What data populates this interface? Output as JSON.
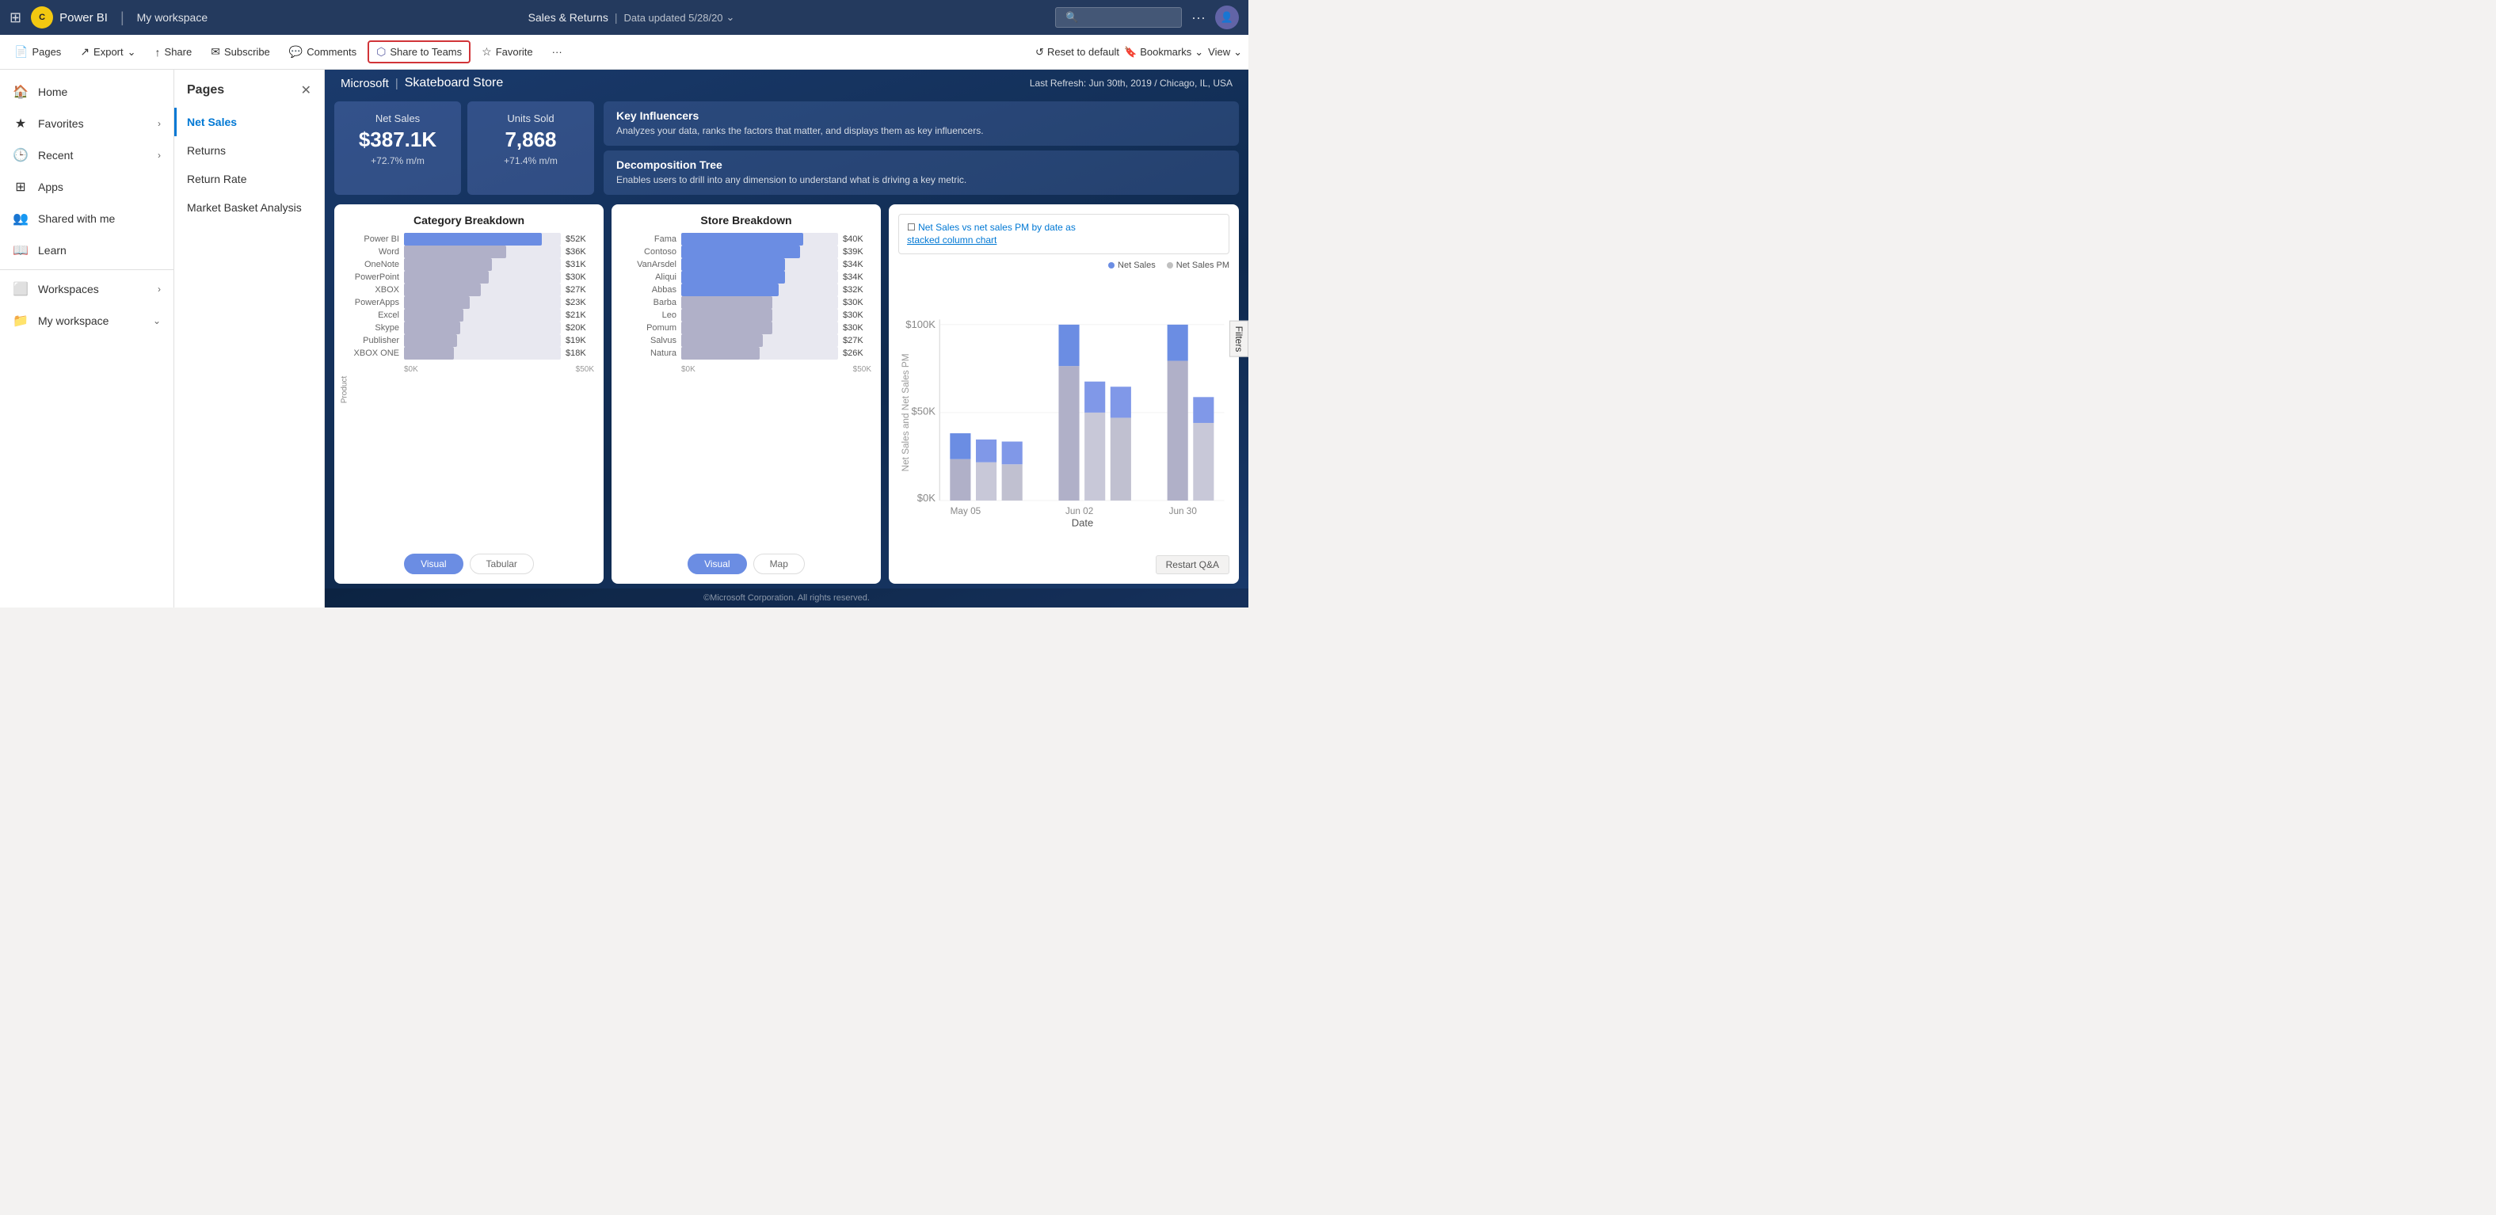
{
  "topnav": {
    "grid_icon": "⊞",
    "brand_logo_text": "C",
    "brand_name": "Power BI",
    "workspace": "My workspace",
    "report_title": "Sales & Returns",
    "data_updated": "Data updated 5/28/20",
    "chevron": "⌄",
    "search_placeholder": "Search",
    "dots": "···",
    "avatar_text": "👤"
  },
  "toolbar": {
    "pages_label": "Pages",
    "export_label": "Export",
    "share_label": "Share",
    "subscribe_label": "Subscribe",
    "comments_label": "Comments",
    "share_teams_label": "Share to Teams",
    "favorite_label": "Favorite",
    "more_icon": "···",
    "reset_label": "Reset to default",
    "bookmarks_label": "Bookmarks",
    "view_label": "View"
  },
  "pages_panel": {
    "title": "Pages",
    "pages": [
      {
        "label": "Net Sales",
        "active": true
      },
      {
        "label": "Returns"
      },
      {
        "label": "Return Rate"
      },
      {
        "label": "Market Basket Analysis"
      }
    ]
  },
  "sidebar": {
    "items": [
      {
        "icon": "🏠",
        "label": "Home",
        "arrow": false
      },
      {
        "icon": "★",
        "label": "Favorites",
        "arrow": true
      },
      {
        "icon": "🕒",
        "label": "Recent",
        "arrow": true
      },
      {
        "icon": "⊞",
        "label": "Apps",
        "arrow": false
      },
      {
        "icon": "👥",
        "label": "Shared with me",
        "arrow": false
      },
      {
        "icon": "📖",
        "label": "Learn",
        "arrow": false
      },
      {
        "icon": "⬜",
        "label": "Workspaces",
        "arrow": true
      },
      {
        "icon": "📁",
        "label": "My workspace",
        "arrow": true
      }
    ]
  },
  "report": {
    "breadcrumb_company": "Microsoft",
    "breadcrumb_sep": "|",
    "breadcrumb_store": "Skateboard Store",
    "last_refresh": "Last Refresh: Jun 30th, 2019 / Chicago, IL, USA",
    "kpis": [
      {
        "label": "Net Sales",
        "value": "$387.1K",
        "change": "+72.7%",
        "change_period": "m/m"
      },
      {
        "label": "Units Sold",
        "value": "7,868",
        "change": "+71.4%",
        "change_period": "m/m"
      }
    ],
    "insights": [
      {
        "title": "Key Influencers",
        "desc": "Analyzes your data, ranks the factors that matter, and displays them as key influencers."
      },
      {
        "title": "Decomposition Tree",
        "desc": "Enables users to drill into any dimension to understand what is driving a key metric."
      }
    ],
    "category_breakdown": {
      "title": "Category Breakdown",
      "axis_label": "Product",
      "bars": [
        {
          "label": "Power BI",
          "value": "$52K",
          "pct": 88,
          "color": "blue"
        },
        {
          "label": "Word",
          "value": "$36K",
          "pct": 65,
          "color": "gray"
        },
        {
          "label": "OneNote",
          "value": "$31K",
          "pct": 56,
          "color": "gray"
        },
        {
          "label": "PowerPoint",
          "value": "$30K",
          "pct": 54,
          "color": "gray"
        },
        {
          "label": "XBOX",
          "value": "$27K",
          "pct": 49,
          "color": "gray"
        },
        {
          "label": "PowerApps",
          "value": "$23K",
          "pct": 42,
          "color": "gray"
        },
        {
          "label": "Excel",
          "value": "$21K",
          "pct": 38,
          "color": "gray"
        },
        {
          "label": "Skype",
          "value": "$20K",
          "pct": 36,
          "color": "gray"
        },
        {
          "label": "Publisher",
          "value": "$19K",
          "pct": 34,
          "color": "gray"
        },
        {
          "label": "XBOX ONE",
          "value": "$18K",
          "pct": 32,
          "color": "gray"
        }
      ],
      "x_labels": [
        "$0K",
        "$50K"
      ],
      "tabs": [
        "Visual",
        "Tabular"
      ]
    },
    "store_breakdown": {
      "title": "Store Breakdown",
      "bars": [
        {
          "label": "Fama",
          "value": "$40K",
          "pct": 78,
          "color": "blue"
        },
        {
          "label": "Contoso",
          "value": "$39K",
          "pct": 76,
          "color": "blue"
        },
        {
          "label": "VanArsdel",
          "value": "$34K",
          "pct": 66,
          "color": "blue"
        },
        {
          "label": "Aliqui",
          "value": "$34K",
          "pct": 66,
          "color": "blue"
        },
        {
          "label": "Abbas",
          "value": "$32K",
          "pct": 62,
          "color": "blue"
        },
        {
          "label": "Barba",
          "value": "$30K",
          "pct": 58,
          "color": "gray"
        },
        {
          "label": "Leo",
          "value": "$30K",
          "pct": 58,
          "color": "gray"
        },
        {
          "label": "Pomum",
          "value": "$30K",
          "pct": 58,
          "color": "gray"
        },
        {
          "label": "Salvus",
          "value": "$27K",
          "pct": 52,
          "color": "gray"
        },
        {
          "label": "Natura",
          "value": "$26K",
          "pct": 50,
          "color": "gray"
        }
      ],
      "x_labels": [
        "$0K",
        "$50K"
      ],
      "tabs": [
        "Visual",
        "Map"
      ]
    },
    "trend_chart": {
      "title": "Net Sales vs net sales PM by date as stacked column chart",
      "legend": [
        "Net Sales",
        "Net Sales PM"
      ],
      "y_labels": [
        "$100K",
        "$50K",
        "$0K"
      ],
      "x_labels": [
        "May 05",
        "Jun 02",
        "Jun 30"
      ],
      "x_axis_label": "Date",
      "y_axis_label": "Net Sales and Net Sales PM",
      "restart_qa": "Restart Q&A"
    },
    "footer": "©Microsoft Corporation. All rights reserved.",
    "filters_label": "Filters"
  }
}
